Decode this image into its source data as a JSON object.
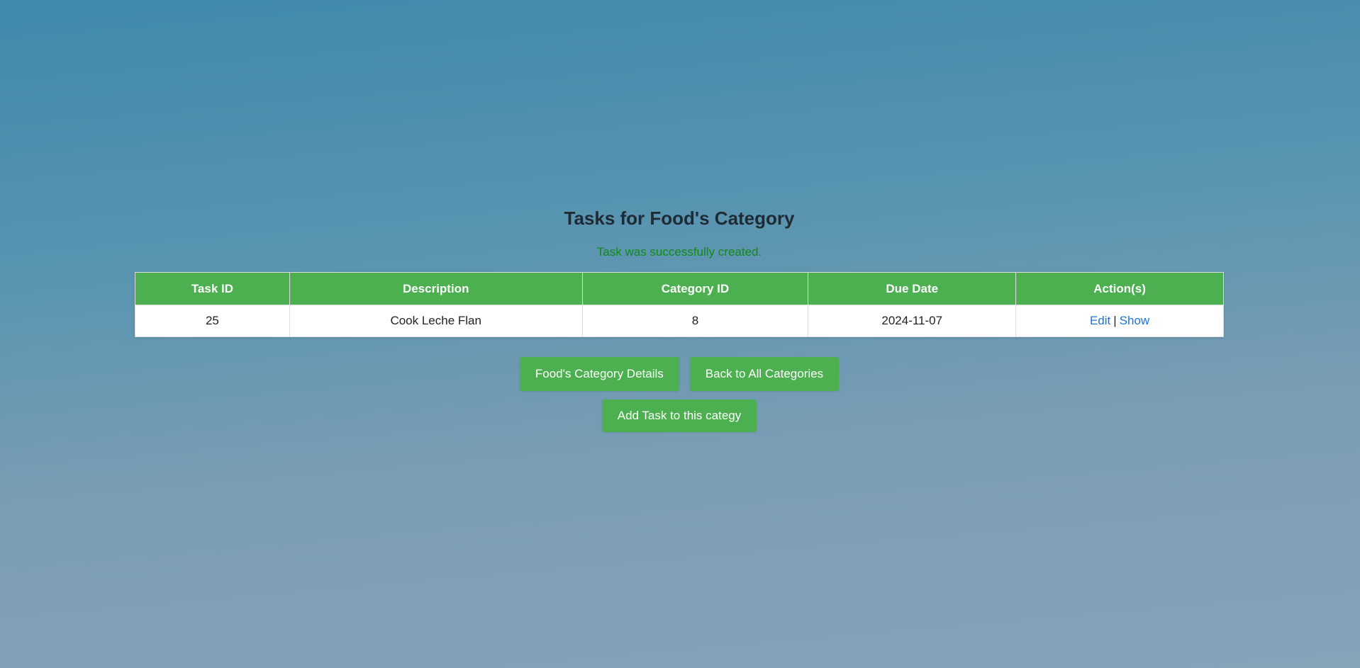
{
  "page": {
    "title": "Tasks for Food's Category",
    "flash_message": "Task was successfully created."
  },
  "table": {
    "headers": [
      "Task ID",
      "Description",
      "Category ID",
      "Due Date",
      "Action(s)"
    ],
    "rows": [
      {
        "task_id": "25",
        "description": "Cook Leche Flan",
        "category_id": "8",
        "due_date": "2024-11-07",
        "actions": {
          "edit": "Edit",
          "separator": "|",
          "show": "Show"
        }
      }
    ]
  },
  "buttons": {
    "category_details": "Food's Category Details",
    "back_to_all": "Back to All Categories",
    "add_task": "Add Task to this categy"
  },
  "colors": {
    "accent": "#4caf50",
    "flash": "#108a18",
    "link": "#1a73d9"
  }
}
